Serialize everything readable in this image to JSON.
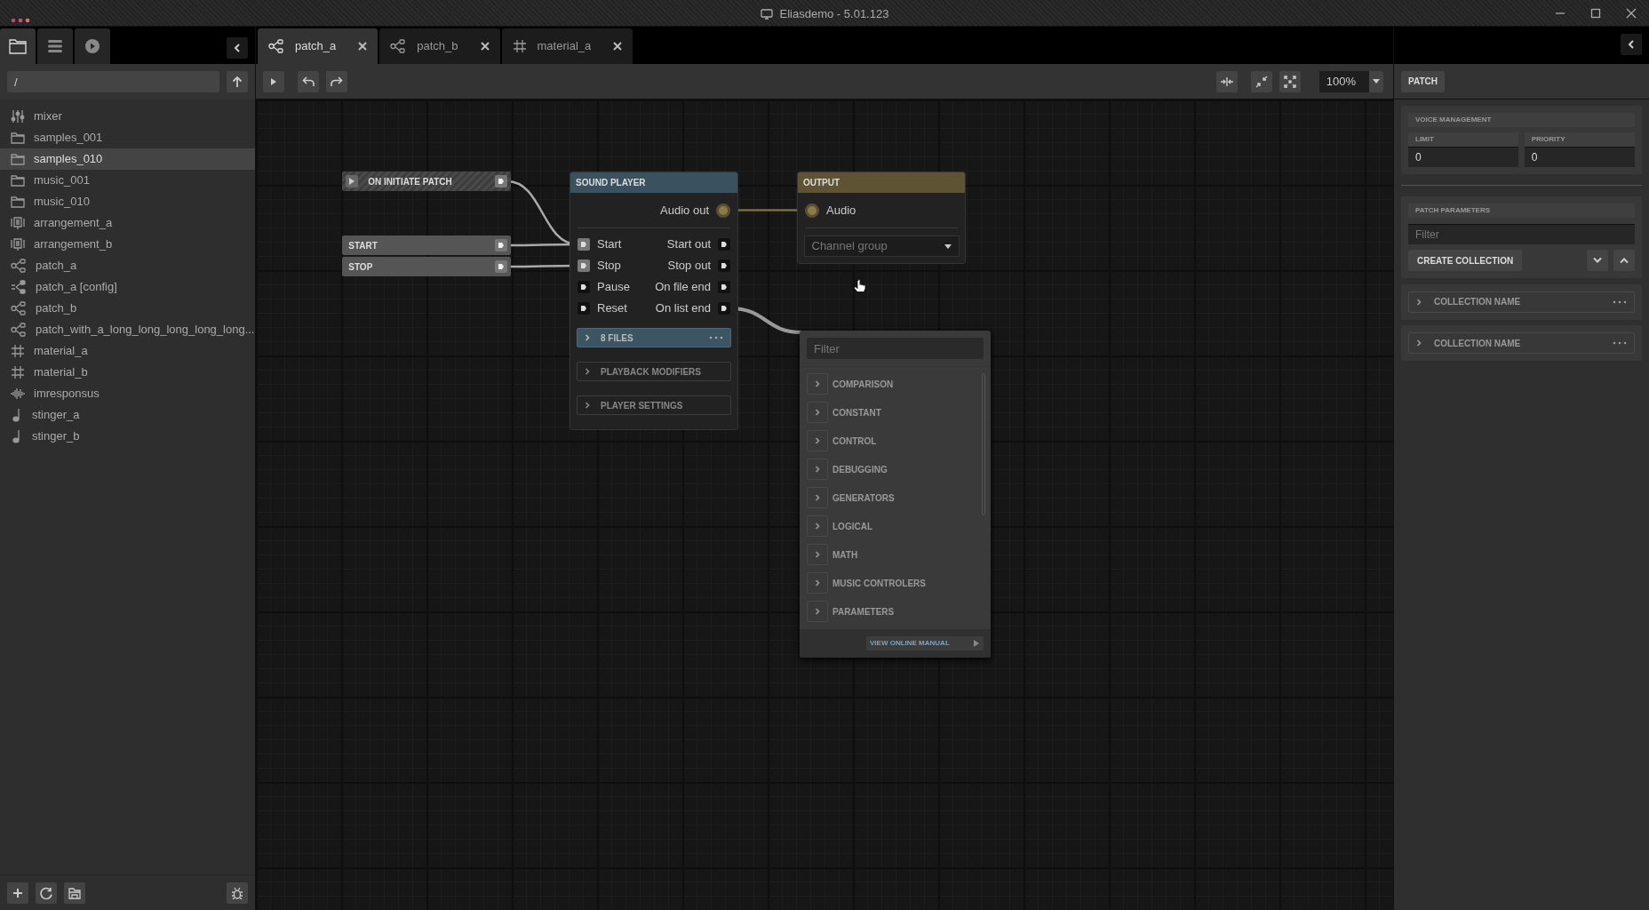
{
  "window": {
    "title": "Eliasdemo - 5.01.123"
  },
  "sidebar": {
    "tabs": [
      {
        "kind": "files",
        "selected": true
      },
      {
        "kind": "list",
        "selected": false
      },
      {
        "kind": "play",
        "selected": false
      }
    ],
    "path": {
      "value": "/"
    },
    "items": [
      {
        "label": "mixer",
        "kind": "mixer",
        "selected": false
      },
      {
        "label": "samples_001",
        "kind": "folder",
        "selected": false
      },
      {
        "label": "samples_010",
        "kind": "folder",
        "selected": true
      },
      {
        "label": "music_001",
        "kind": "folder",
        "selected": false
      },
      {
        "label": "music_010",
        "kind": "folder",
        "selected": false
      },
      {
        "label": "arrangement_a",
        "kind": "arrangement",
        "selected": false
      },
      {
        "label": "arrangement_b",
        "kind": "arrangement",
        "selected": false
      },
      {
        "label": "patch_a",
        "kind": "patch",
        "selected": false
      },
      {
        "label": "patch_a [config]",
        "kind": "patch-config",
        "selected": false
      },
      {
        "label": "patch_b",
        "kind": "patch",
        "selected": false
      },
      {
        "label": "patch_with_a_long_long_long_long_long...",
        "kind": "patch",
        "selected": false
      },
      {
        "label": "material_a",
        "kind": "material",
        "selected": false
      },
      {
        "label": "material_b",
        "kind": "material",
        "selected": false
      },
      {
        "label": "imresponsus",
        "kind": "impulse",
        "selected": false
      },
      {
        "label": "stinger_a",
        "kind": "audio",
        "selected": false
      },
      {
        "label": "stinger_b",
        "kind": "audio",
        "selected": false
      }
    ]
  },
  "editor_tabs": [
    {
      "label": "patch_a",
      "kind": "patch",
      "selected": true
    },
    {
      "label": "patch_b",
      "kind": "patch",
      "selected": false
    },
    {
      "label": "material_a",
      "kind": "material",
      "selected": false
    }
  ],
  "toolbar": {
    "zoom": "100%"
  },
  "canvas": {
    "events": [
      {
        "label": "ON INITIATE PATCH",
        "kind": "initiate"
      },
      {
        "label": "START",
        "kind": "event"
      },
      {
        "label": "STOP",
        "kind": "event"
      }
    ],
    "sound_player": {
      "title": "SOUND PLAYER",
      "audio_out": "Audio out",
      "rows": [
        {
          "input": "Start",
          "output": "Start out",
          "connected": true
        },
        {
          "input": "Stop",
          "output": "Stop out",
          "connected": true
        },
        {
          "input": "Pause",
          "output": "On file end",
          "connected": false
        },
        {
          "input": "Reset",
          "output": "On list end",
          "connected": false
        }
      ],
      "sections": [
        {
          "label": "8 FILES",
          "kind": "files"
        },
        {
          "label": "PLAYBACK MODIFIERS",
          "kind": "group"
        },
        {
          "label": "PLAYER SETTINGS",
          "kind": "group"
        }
      ]
    },
    "output": {
      "title": "OUTPUT",
      "input": "Audio",
      "channel_group": {
        "placeholder": "Channel group"
      }
    }
  },
  "node_menu": {
    "filter": {
      "placeholder": "Filter"
    },
    "categories": [
      "COMPARISON",
      "CONSTANT",
      "CONTROL",
      "DEBUGGING",
      "GENERATORS",
      "LOGICAL",
      "MATH",
      "MUSIC CONTROLERS",
      "PARAMETERS"
    ],
    "manual_link": "VIEW ONLINE MANUAL"
  },
  "inspector": {
    "tab": "PATCH",
    "voice_management": {
      "title": "VOICE MANAGEMENT",
      "limit": {
        "label": "LIMIT",
        "value": "0"
      },
      "priority": {
        "label": "PRIORITY",
        "value": "0"
      }
    },
    "patch_parameters": {
      "title": "PATCH PARAMETERS",
      "filter": {
        "placeholder": "Filter"
      },
      "create_button": "CREATE COLLECTION"
    },
    "collections": [
      "COLLECTION NAME",
      "COLLECTION NAME"
    ]
  }
}
